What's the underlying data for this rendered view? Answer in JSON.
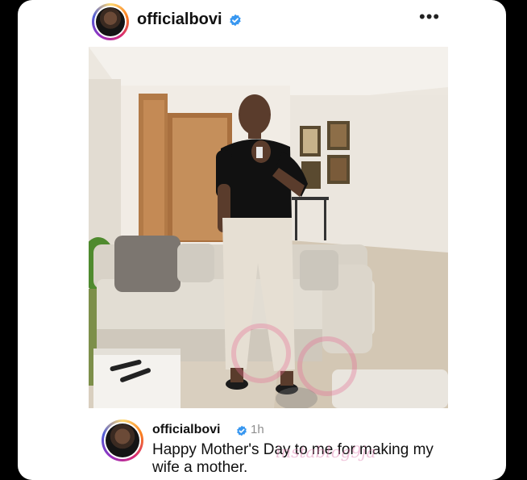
{
  "post": {
    "username": "officialbovi",
    "menu_icon": "more-horizontal-icon",
    "verified_icon": "verified-badge-icon",
    "accent_color": "#3897f0"
  },
  "caption": {
    "username": "officialbovi",
    "time": "1h",
    "text": "Happy Mother's Day to me for making my wife a mother."
  },
  "watermark": {
    "text": "instablog9ja"
  }
}
